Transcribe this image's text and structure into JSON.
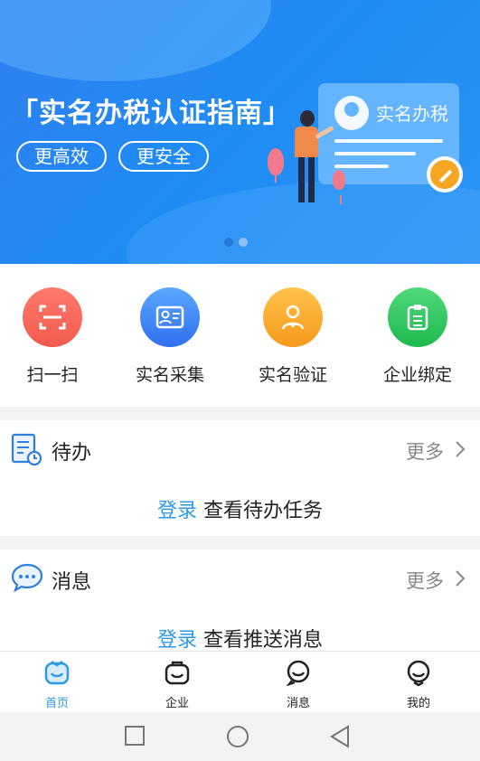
{
  "banner": {
    "title": "「实名办税认证指南」",
    "pill_1": "更高效",
    "pill_2": "更安全",
    "card_label": "实名办税",
    "dots_total": 2,
    "dots_active_index": 0
  },
  "quick_actions": [
    {
      "label": "扫一扫",
      "icon": "scan-icon",
      "color": "#f25a4f"
    },
    {
      "label": "实名采集",
      "icon": "id-card-icon",
      "color": "#2f6ff0"
    },
    {
      "label": "实名验证",
      "icon": "user-verify-icon",
      "color": "#f59a1c"
    },
    {
      "label": "企业绑定",
      "icon": "clipboard-icon",
      "color": "#1fb94f"
    }
  ],
  "todo": {
    "title": "待办",
    "more": "更多",
    "login_link": "登录",
    "body_text": " 查看待办任务"
  },
  "messages": {
    "title": "消息",
    "more": "更多",
    "login_link": "登录",
    "body_text": " 查看推送消息"
  },
  "tabbar": {
    "active_color": "#2e9ae8",
    "tabs": [
      {
        "label": "首页",
        "icon": "home-icon",
        "active": true
      },
      {
        "label": "企业",
        "icon": "company-icon",
        "active": false
      },
      {
        "label": "消息",
        "icon": "message-icon",
        "active": false
      },
      {
        "label": "我的",
        "icon": "profile-icon",
        "active": false
      }
    ]
  },
  "system_nav": [
    "recent-apps-icon",
    "home-circle-icon",
    "back-triangle-icon"
  ]
}
